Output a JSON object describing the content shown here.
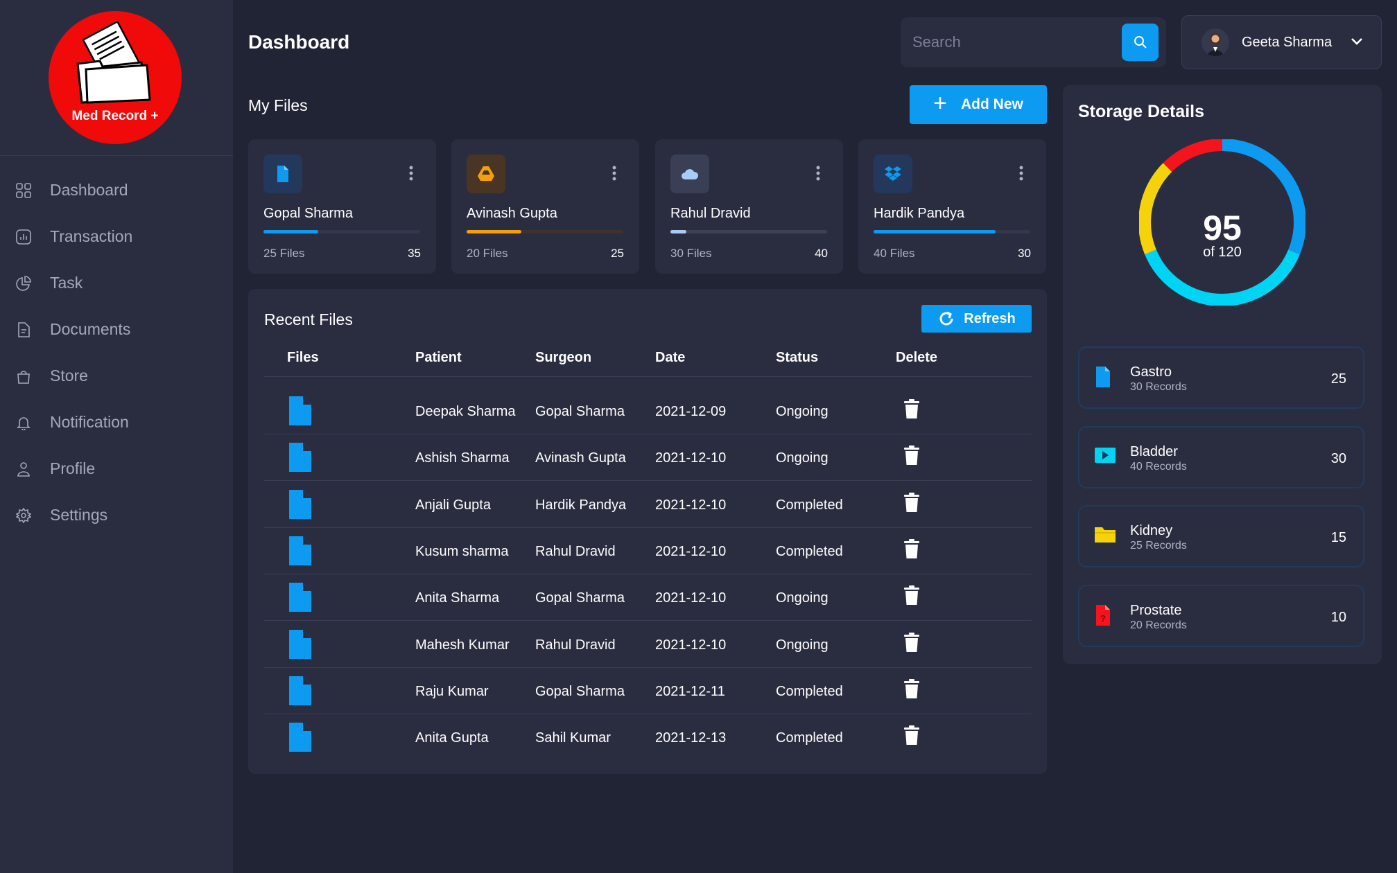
{
  "app": {
    "logo_text": "Med Record +"
  },
  "sidebar": {
    "items": [
      {
        "label": "Dashboard",
        "icon": "dashboard-icon"
      },
      {
        "label": "Transaction",
        "icon": "transaction-icon"
      },
      {
        "label": "Task",
        "icon": "task-icon"
      },
      {
        "label": "Documents",
        "icon": "documents-icon"
      },
      {
        "label": "Store",
        "icon": "store-icon"
      },
      {
        "label": "Notification",
        "icon": "bell-icon"
      },
      {
        "label": "Profile",
        "icon": "user-icon"
      },
      {
        "label": "Settings",
        "icon": "gear-icon"
      }
    ]
  },
  "header": {
    "title": "Dashboard",
    "search_placeholder": "Search",
    "user_name": "Geeta Sharma"
  },
  "my_files": {
    "title": "My Files",
    "add_label": "Add New",
    "cards": [
      {
        "name": "Gopal Sharma",
        "files": "25 Files",
        "count": "35",
        "progress": 0.35,
        "color": "#0d9bf2",
        "icon": "file-icon"
      },
      {
        "name": "Avinash Gupta",
        "files": "20 Files",
        "count": "25",
        "progress": 0.35,
        "color": "#f5a00a",
        "icon": "google-drive-icon"
      },
      {
        "name": "Rahul Dravid",
        "files": "30 Files",
        "count": "40",
        "progress": 0.1,
        "color": "#a9ccf5",
        "icon": "cloud-icon"
      },
      {
        "name": "Hardik Pandya",
        "files": "40 Files",
        "count": "30",
        "progress": 0.78,
        "color": "#0d9bf2",
        "icon": "dropbox-icon"
      }
    ]
  },
  "recent_files": {
    "title": "Recent Files",
    "refresh_label": "Refresh",
    "columns": [
      "Files",
      "Patient",
      "Surgeon",
      "Date",
      "Status",
      "Delete"
    ],
    "rows": [
      {
        "patient": "Deepak Sharma",
        "surgeon": "Gopal Sharma",
        "date": "2021-12-09",
        "status": "Ongoing"
      },
      {
        "patient": "Ashish Sharma",
        "surgeon": "Avinash Gupta",
        "date": "2021-12-10",
        "status": "Ongoing"
      },
      {
        "patient": "Anjali Gupta",
        "surgeon": "Hardik Pandya",
        "date": "2021-12-10",
        "status": "Completed"
      },
      {
        "patient": "Kusum sharma",
        "surgeon": "Rahul Dravid",
        "date": "2021-12-10",
        "status": "Completed"
      },
      {
        "patient": "Anita Sharma",
        "surgeon": "Gopal Sharma",
        "date": "2021-12-10",
        "status": "Ongoing"
      },
      {
        "patient": "Mahesh Kumar",
        "surgeon": "Rahul Dravid",
        "date": "2021-12-10",
        "status": "Ongoing"
      },
      {
        "patient": "Raju Kumar",
        "surgeon": "Gopal Sharma",
        "date": "2021-12-11",
        "status": "Completed"
      },
      {
        "patient": "Anita Gupta",
        "surgeon": "Sahil Kumar",
        "date": "2021-12-13",
        "status": "Completed"
      }
    ]
  },
  "storage": {
    "title": "Storage Details",
    "used": "95",
    "total_label": "of 120",
    "categories": [
      {
        "name": "Gastro",
        "records": "30 Records",
        "value": "25",
        "color": "#0d9bf2",
        "icon": "file-icon"
      },
      {
        "name": "Bladder",
        "records": "40 Records",
        "value": "30",
        "color": "#00d4f5",
        "icon": "media-icon"
      },
      {
        "name": "Kidney",
        "records": "25 Records",
        "value": "15",
        "color": "#f5d20a",
        "icon": "folder-icon"
      },
      {
        "name": "Prostate",
        "records": "20 Records",
        "value": "10",
        "color": "#f5141e",
        "icon": "file-unknown-icon"
      }
    ]
  }
}
